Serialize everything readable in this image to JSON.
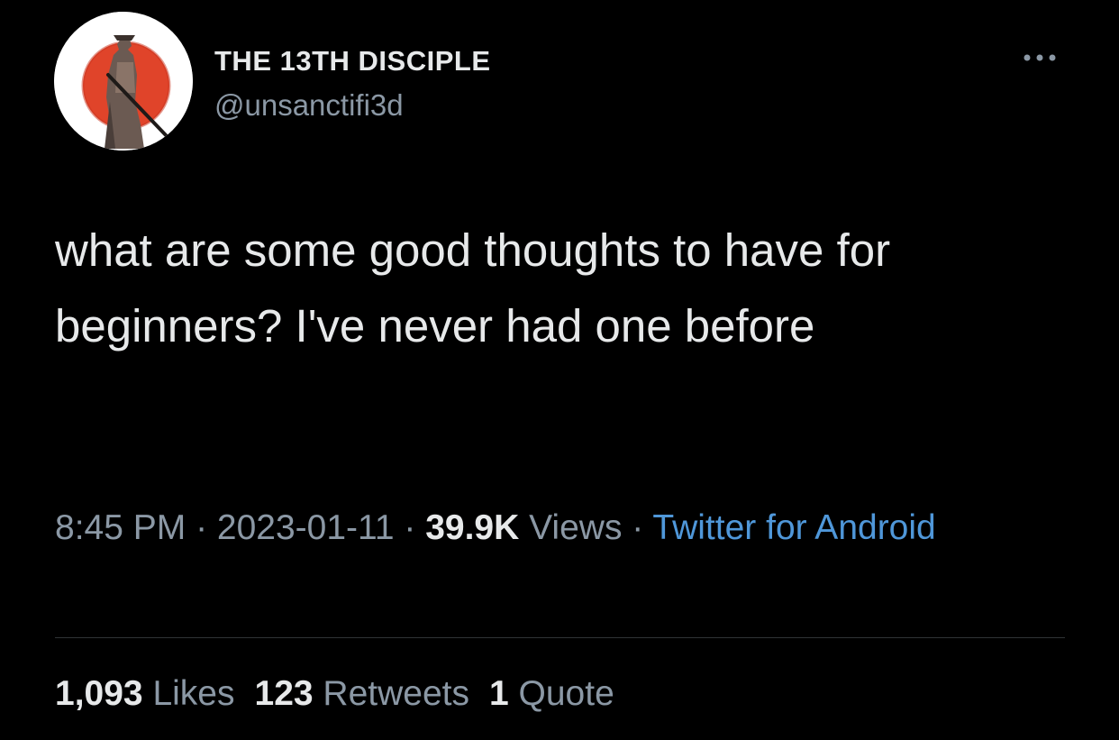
{
  "author": {
    "display_name": "THE 13TH DISCIPLE",
    "handle": "@unsanctifi3d",
    "avatar_icon": "samurai-sun-avatar"
  },
  "tweet": {
    "text": "what are some good thoughts to have for beginners? I've never had one before"
  },
  "meta": {
    "time": "8:45 PM",
    "separator": " · ",
    "date": "2023-01-11",
    "views_count": "39.9K",
    "views_label": " Views",
    "source": "Twitter for Android"
  },
  "stats": {
    "likes_count": "1,093",
    "likes_label": " Likes",
    "retweets_count": "123",
    "retweets_label": " Retweets",
    "quotes_count": "1",
    "quotes_label": " Quote"
  },
  "icons": {
    "more": "more-horizontal-icon"
  },
  "colors": {
    "background": "#000000",
    "text_primary": "#e7e9ea",
    "text_secondary": "#8b98a5",
    "link": "#4f97d9",
    "divider": "#2f3336"
  }
}
